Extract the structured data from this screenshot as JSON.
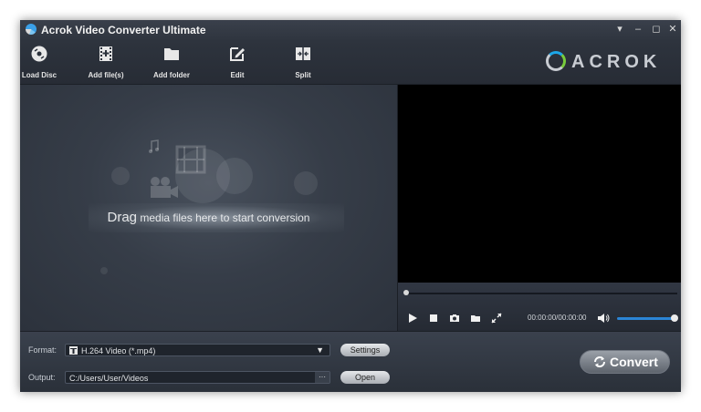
{
  "window": {
    "title": "Acrok Video Converter Ultimate"
  },
  "titlebar": {
    "dropdown_icon": "▾",
    "minimize_icon": "–",
    "maximize_icon": "◻",
    "close_icon": "✕"
  },
  "toolbar": {
    "items": [
      {
        "label": "Load Disc",
        "icon": "disc-icon"
      },
      {
        "label": "Add file(s)",
        "icon": "film-add-icon"
      },
      {
        "label": "Add folder",
        "icon": "folder-icon"
      },
      {
        "label": "Edit",
        "icon": "edit-icon"
      },
      {
        "label": "Split",
        "icon": "split-icon"
      }
    ]
  },
  "brand": {
    "text": "ACROK"
  },
  "dropzone": {
    "emphasis": "Drag",
    "text": "media files here to start conversion"
  },
  "player": {
    "time": "00:00:00/00:00:00",
    "seek_progress": 0,
    "volume": 1.0
  },
  "format": {
    "label": "Format:",
    "value": "H.264 Video (*.mp4)",
    "settings_label": "Settings"
  },
  "output": {
    "label": "Output:",
    "value": "C:/Users/User/Videos",
    "browse_label": "···",
    "open_label": "Open"
  },
  "convert": {
    "label": "Convert"
  },
  "colors": {
    "accent": "#2b85d6",
    "background": "#2f3540"
  }
}
